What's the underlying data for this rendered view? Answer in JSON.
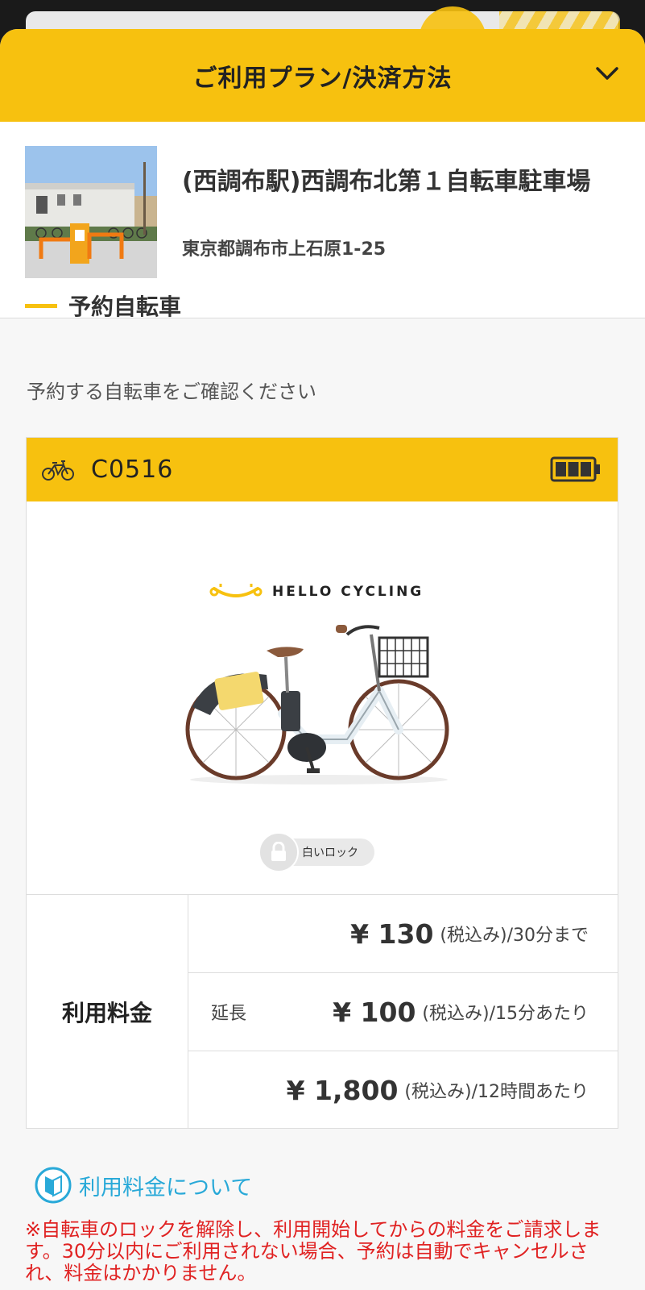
{
  "header": {
    "title": "ご利用プラン/決済方法"
  },
  "station": {
    "name": "(西調布駅)西調布北第１自転車駐車場",
    "address": "東京都調布市上石原1-25",
    "section_label": "予約自転車"
  },
  "confirm_text": "予約する自転車をご確認ください",
  "bike": {
    "id": "C0516",
    "battery_level": 1.0,
    "brand": "HELLO CYCLING",
    "lock_label": "白いロック"
  },
  "pricing": {
    "label": "利用料金",
    "rows": [
      {
        "prefix": "",
        "amount": "¥ 130",
        "unit": "(税込み)/30分まで"
      },
      {
        "prefix": "延長",
        "amount": "¥ 100",
        "unit": "(税込み)/15分あたり"
      },
      {
        "prefix": "",
        "amount": "¥ 1,800",
        "unit": "(税込み)/12時間あたり"
      }
    ]
  },
  "info_link": "利用料金について",
  "notice": "※自転車のロックを解除し、利用開始してからの料金をご請求します。30分以内にご利用されない場合、予約は自動でキャンセルされ、料金はかかりません。",
  "colors": {
    "accent": "#f7c10f",
    "link": "#29a9d8",
    "warning": "#e02222"
  }
}
